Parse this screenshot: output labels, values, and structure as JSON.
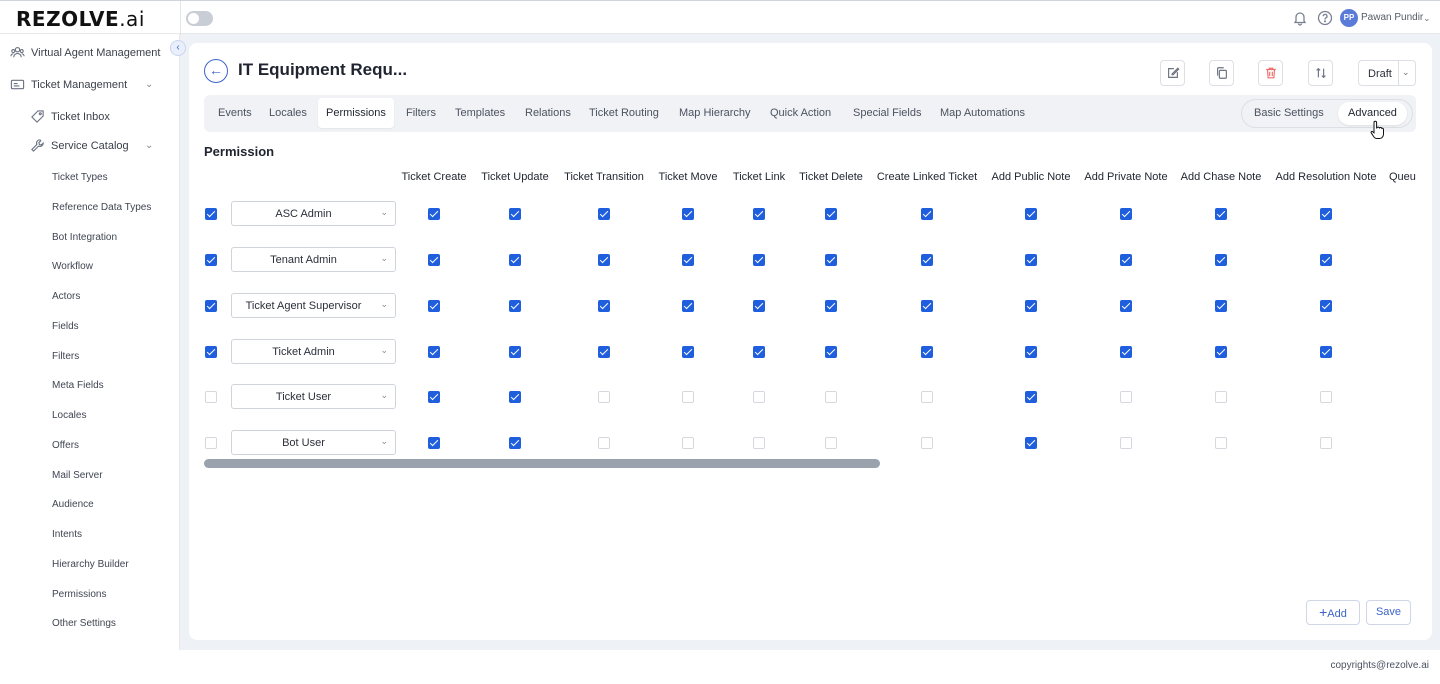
{
  "brand": {
    "logo": "REZOLVE",
    "logo_suffix": ".ai"
  },
  "topbar": {
    "user_initials": "PP",
    "user_name": "Pawan Pundir"
  },
  "sidebar": {
    "virtual_agent": "Virtual Agent Management",
    "ticket_mgmt": "Ticket Management",
    "ticket_inbox": "Ticket Inbox",
    "service_catalog": "Service Catalog",
    "items": [
      "Ticket Types",
      "Reference Data Types",
      "Bot Integration",
      "Workflow",
      "Actors",
      "Fields",
      "Filters",
      "Meta Fields",
      "Locales",
      "Offers",
      "Mail Server",
      "Audience",
      "Intents",
      "Hierarchy Builder",
      "Permissions",
      "Other Settings"
    ]
  },
  "page": {
    "title": "IT Equipment Requ...",
    "status": "Draft",
    "section_title": "Permission"
  },
  "tabs": [
    "Events",
    "Locales",
    "Permissions",
    "Filters",
    "Templates",
    "Relations",
    "Ticket Routing",
    "Map Hierarchy",
    "Quick Action",
    "Special Fields",
    "Map Automations"
  ],
  "active_tab": "Permissions",
  "segment": {
    "basic": "Basic Settings",
    "advanced": "Advanced",
    "active": "Advanced"
  },
  "table": {
    "columns": [
      "Ticket Create",
      "Ticket Update",
      "Ticket Transition",
      "Ticket Move",
      "Ticket Link",
      "Ticket Delete",
      "Create Linked Ticket",
      "Add Public Note",
      "Add Private Note",
      "Add Chase Note",
      "Add Resolution Note",
      "Queu"
    ],
    "rows": [
      {
        "selected": true,
        "role": "ASC Admin",
        "perms": [
          true,
          true,
          true,
          true,
          true,
          true,
          true,
          true,
          true,
          true,
          true
        ]
      },
      {
        "selected": true,
        "role": "Tenant Admin",
        "perms": [
          true,
          true,
          true,
          true,
          true,
          true,
          true,
          true,
          true,
          true,
          true
        ]
      },
      {
        "selected": true,
        "role": "Ticket Agent Supervisor",
        "perms": [
          true,
          true,
          true,
          true,
          true,
          true,
          true,
          true,
          true,
          true,
          true
        ]
      },
      {
        "selected": true,
        "role": "Ticket Admin",
        "perms": [
          true,
          true,
          true,
          true,
          true,
          true,
          true,
          true,
          true,
          true,
          true
        ]
      },
      {
        "selected": false,
        "role": "Ticket User",
        "perms": [
          true,
          true,
          false,
          false,
          false,
          false,
          false,
          true,
          false,
          false,
          false
        ]
      },
      {
        "selected": false,
        "role": "Bot User",
        "perms": [
          true,
          true,
          false,
          false,
          false,
          false,
          false,
          true,
          false,
          false,
          false
        ]
      }
    ]
  },
  "actions": {
    "add": "Add",
    "save": "Save"
  },
  "footer": {
    "copyright": "copyrights@rezolve.ai"
  },
  "colors": {
    "accent": "#3d63c8",
    "checkbox": "#1f5fde",
    "danger": "#ef6b6b"
  }
}
